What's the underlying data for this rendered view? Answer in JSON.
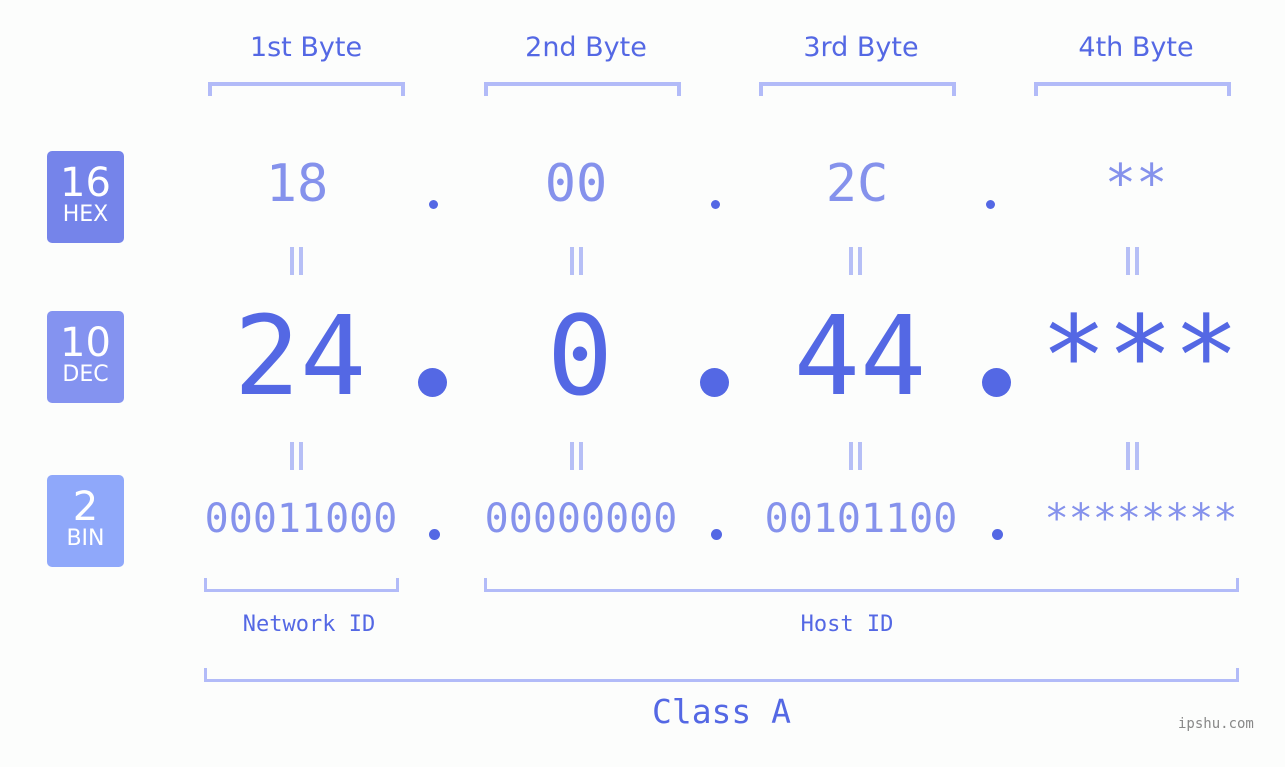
{
  "bytes": [
    {
      "header": "1st Byte",
      "hex": "18",
      "dec": "24",
      "bin": "00011000"
    },
    {
      "header": "2nd Byte",
      "hex": "00",
      "dec": "0",
      "bin": "00000000"
    },
    {
      "header": "3rd Byte",
      "hex": "2C",
      "dec": "44",
      "bin": "00101100"
    },
    {
      "header": "4th Byte",
      "hex": "**",
      "dec": "***",
      "bin": "********"
    }
  ],
  "badges": {
    "hex": {
      "num": "16",
      "label": "HEX",
      "color": "#7584ea"
    },
    "dec": {
      "num": "10",
      "label": "DEC",
      "color": "#8493f0"
    },
    "bin": {
      "num": "2",
      "label": "BIN",
      "color": "#8fa8fa"
    }
  },
  "labels": {
    "network_id": "Network ID",
    "host_id": "Host ID",
    "class": "Class A"
  },
  "watermark": "ipshu.com",
  "colors": {
    "accent": "#5468e4",
    "light_accent": "#8592ec",
    "bracket": "#b2bbf8"
  }
}
